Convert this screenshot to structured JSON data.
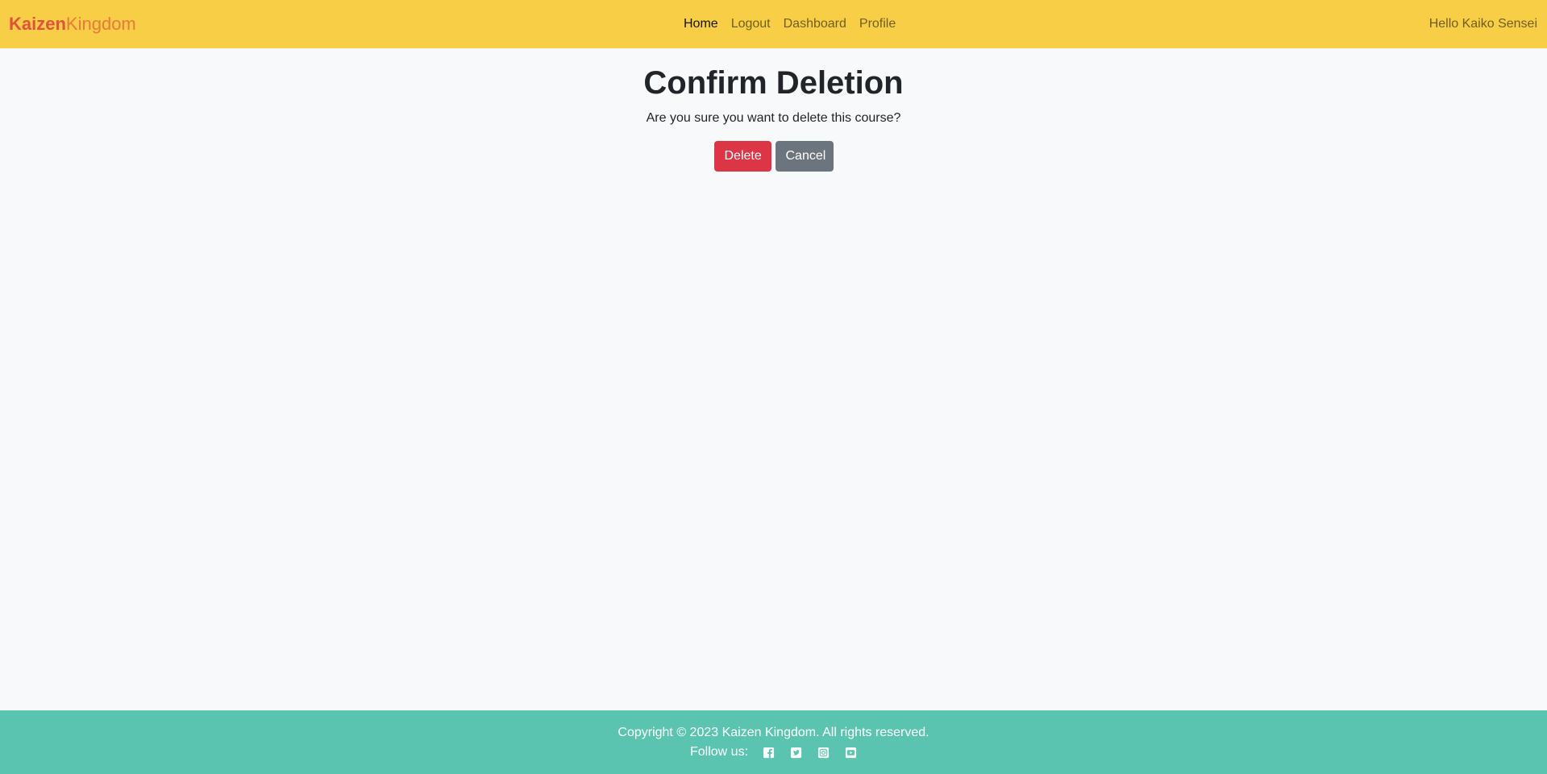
{
  "navbar": {
    "brand_part1": "Kaizen",
    "brand_part2": "Kingdom",
    "links": [
      {
        "label": "Home",
        "active": true
      },
      {
        "label": "Logout"
      },
      {
        "label": "Dashboard"
      },
      {
        "label": "Profile"
      }
    ],
    "greeting": "Hello Kaiko Sensei"
  },
  "main": {
    "title": "Confirm Deletion",
    "message": "Are you sure you want to delete this course?",
    "delete_label": "Delete",
    "cancel_label": "Cancel"
  },
  "footer": {
    "copyright": "Copyright © 2023 Kaizen Kingdom. All rights reserved.",
    "follow_label": "Follow us:",
    "social_icons": [
      "facebook-icon",
      "twitter-icon",
      "instagram-icon",
      "youtube-icon"
    ]
  },
  "colors": {
    "navbar_bg": "#f7ce46",
    "footer_bg": "#5bc4b0",
    "danger": "#dc3545",
    "secondary": "#6c757d"
  }
}
